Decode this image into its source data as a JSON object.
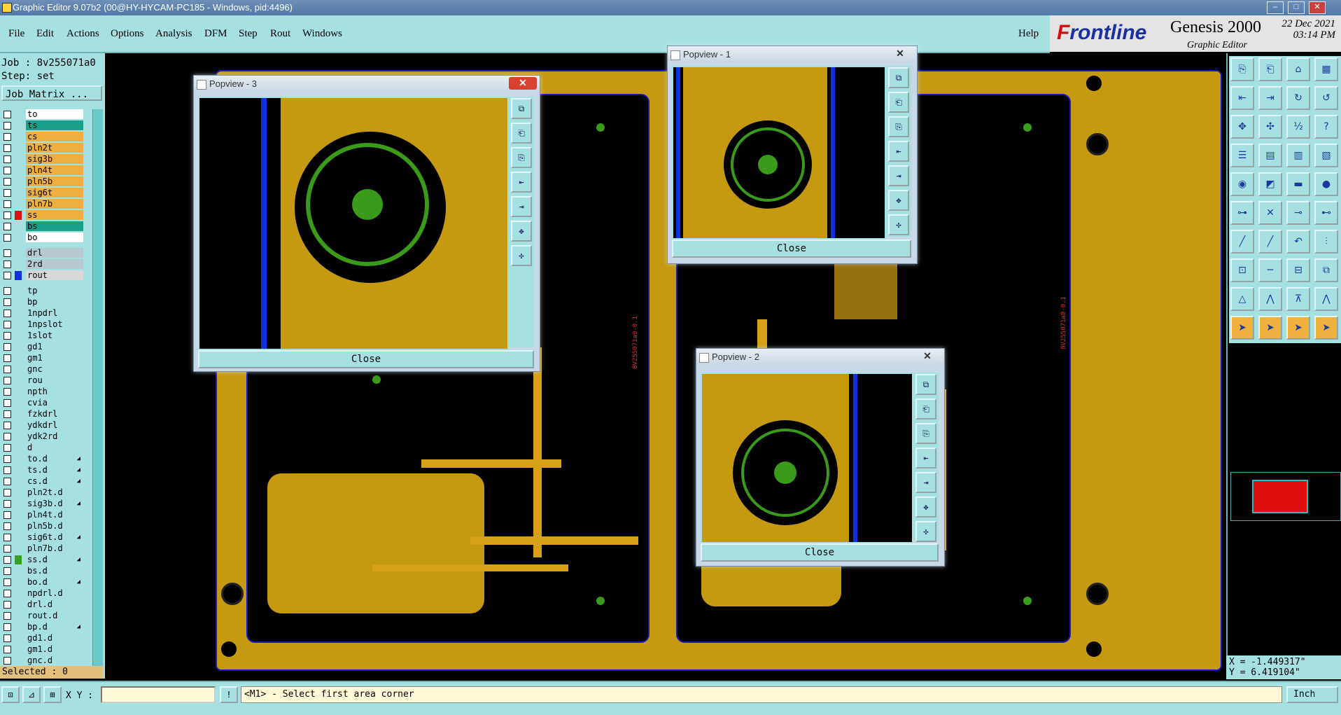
{
  "window": {
    "title": "Graphic Editor 9.07b2 (00@HY-HYCAM-PC185 - Windows, pid:4496)",
    "min": "–",
    "max": "□",
    "close": "✕"
  },
  "menu": {
    "file": "File",
    "edit": "Edit",
    "actions": "Actions",
    "options": "Options",
    "analysis": "Analysis",
    "dfm": "DFM",
    "step": "Step",
    "rout": "Rout",
    "windows": "Windows",
    "help": "Help"
  },
  "brand": {
    "frontline_a": "F",
    "frontline_b": "rontline",
    "product": "Genesis 2000",
    "subtitle": "Graphic Editor",
    "date": "22 Dec 2021",
    "time": "03:14 PM"
  },
  "job": {
    "job": "Job : 8v255071a0",
    "step": "Step: set",
    "matrix": "Job Matrix ..."
  },
  "layers": [
    {
      "name": "to",
      "color": "#ffffff"
    },
    {
      "name": "ts",
      "color": "#1aa08a"
    },
    {
      "name": "cs",
      "color": "#f0b040"
    },
    {
      "name": "pln2t",
      "color": "#f0b040"
    },
    {
      "name": "sig3b",
      "color": "#f0b040"
    },
    {
      "name": "pln4t",
      "color": "#f0b040"
    },
    {
      "name": "pln5b",
      "color": "#f0b040"
    },
    {
      "name": "sig6t",
      "color": "#f0b040"
    },
    {
      "name": "pln7b",
      "color": "#f0b040"
    },
    {
      "name": "ss",
      "color": "#f0b040",
      "swatch": "#e01010"
    },
    {
      "name": "bs",
      "color": "#1aa08a"
    },
    {
      "name": "bo",
      "color": "#ffffff"
    },
    {
      "name": "drl",
      "color": "#b8c8d0"
    },
    {
      "name": "2rd",
      "color": "#b8c8d0"
    },
    {
      "name": "rout",
      "color": "#d8d8d8",
      "swatch": "#1030e0"
    },
    {
      "name": "tp",
      "color": "#a6e1e1"
    },
    {
      "name": "bp",
      "color": "#a6e1e1"
    },
    {
      "name": "1npdrl",
      "color": "#a6e1e1"
    },
    {
      "name": "1npslot",
      "color": "#a6e1e1"
    },
    {
      "name": "1slot",
      "color": "#a6e1e1"
    },
    {
      "name": "gd1",
      "color": "#a6e1e1"
    },
    {
      "name": "gm1",
      "color": "#a6e1e1"
    },
    {
      "name": "gnc",
      "color": "#a6e1e1"
    },
    {
      "name": "rou",
      "color": "#a6e1e1"
    },
    {
      "name": "npth",
      "color": "#a6e1e1"
    },
    {
      "name": "cvia",
      "color": "#a6e1e1"
    },
    {
      "name": "fzkdrl",
      "color": "#a6e1e1"
    },
    {
      "name": "ydkdrl",
      "color": "#a6e1e1"
    },
    {
      "name": "ydk2rd",
      "color": "#a6e1e1"
    },
    {
      "name": "d",
      "color": "#a6e1e1"
    },
    {
      "name": "to.d",
      "color": "#a6e1e1",
      "mark": "◢"
    },
    {
      "name": "ts.d",
      "color": "#a6e1e1",
      "mark": "◢"
    },
    {
      "name": "cs.d",
      "color": "#a6e1e1",
      "mark": "◢"
    },
    {
      "name": "pln2t.d",
      "color": "#a6e1e1"
    },
    {
      "name": "sig3b.d",
      "color": "#a6e1e1",
      "mark": "◢"
    },
    {
      "name": "pln4t.d",
      "color": "#a6e1e1"
    },
    {
      "name": "pln5b.d",
      "color": "#a6e1e1"
    },
    {
      "name": "sig6t.d",
      "color": "#a6e1e1",
      "mark": "◢"
    },
    {
      "name": "pln7b.d",
      "color": "#a6e1e1"
    },
    {
      "name": "ss.d",
      "color": "#a6e1e1",
      "swatch": "#3aa020",
      "mark": "◢"
    },
    {
      "name": "bs.d",
      "color": "#a6e1e1"
    },
    {
      "name": "bo.d",
      "color": "#a6e1e1",
      "mark": "◢"
    },
    {
      "name": "npdrl.d",
      "color": "#a6e1e1"
    },
    {
      "name": "drl.d",
      "color": "#a6e1e1"
    },
    {
      "name": "rout.d",
      "color": "#a6e1e1"
    },
    {
      "name": "bp.d",
      "color": "#a6e1e1",
      "mark": "◢"
    },
    {
      "name": "gd1.d",
      "color": "#a6e1e1"
    },
    {
      "name": "gm1.d",
      "color": "#a6e1e1"
    },
    {
      "name": "gnc.d",
      "color": "#a6e1e1"
    }
  ],
  "selected": "Selected : 0",
  "coords": {
    "x": "X = -1.449317\"",
    "y": "Y = 6.419104\""
  },
  "status": {
    "xy_label": "X Y :",
    "xy_value": "",
    "prompt": "<M1> - Select first area corner",
    "unit": "Inch"
  },
  "popviews": {
    "p3": {
      "title": "Popview - 3",
      "close": "Close"
    },
    "p1": {
      "title": "Popview - 1",
      "close": "Close"
    },
    "p2": {
      "title": "Popview - 2",
      "close": "Close"
    }
  },
  "board_text": {
    "label_left": "8V255071a0-0.1",
    "label_right": "8V255071a0-0.1"
  },
  "colors": {
    "pcb": "#c59a10",
    "outline": "#1a1ab8",
    "via": "#3a9a1a",
    "ui": "#a6e1e1"
  }
}
